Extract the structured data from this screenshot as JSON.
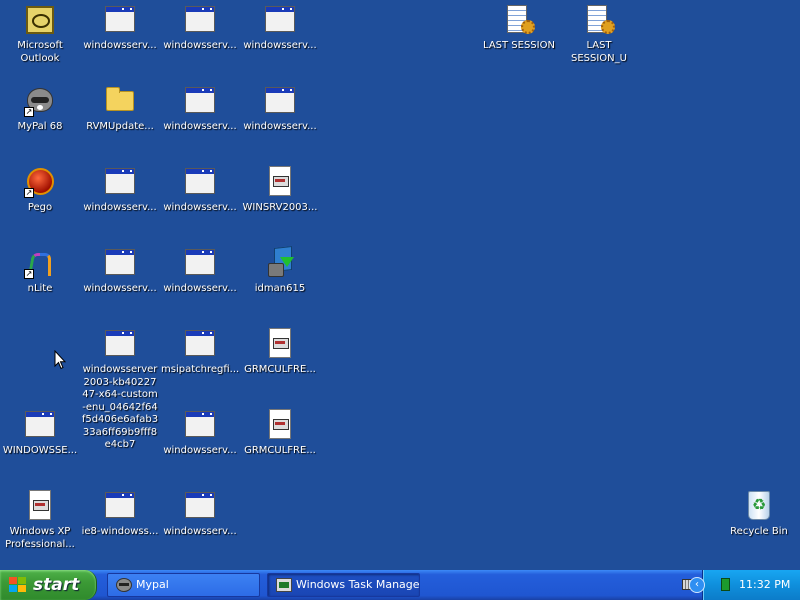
{
  "desktop": {
    "icons": [
      {
        "name": "outlook",
        "type": "outlook",
        "label": "Microsoft Outlook"
      },
      {
        "name": "windowsserv-1",
        "type": "window",
        "label": "windowsserv..."
      },
      {
        "name": "windowsserv-2",
        "type": "window",
        "label": "windowsserv..."
      },
      {
        "name": "windowsserv-3",
        "type": "window",
        "label": "windowsserv..."
      },
      {
        "name": "last-session",
        "type": "log",
        "label": "LAST SESSION"
      },
      {
        "name": "last-session-u",
        "type": "log",
        "label": "LAST SESSION_U"
      },
      {
        "name": "mypal",
        "type": "raccoon",
        "label": "MyPal 68"
      },
      {
        "name": "rvmupdate",
        "type": "folder",
        "label": "RVMUpdate..."
      },
      {
        "name": "windowsserv-4",
        "type": "window",
        "label": "windowsserv..."
      },
      {
        "name": "windowsserv-5",
        "type": "window",
        "label": "windowsserv..."
      },
      {
        "name": "pego",
        "type": "pego",
        "label": "Pego"
      },
      {
        "name": "windowsserv-6",
        "type": "window",
        "label": "windowsserv..."
      },
      {
        "name": "windowsserv-7",
        "type": "window",
        "label": "windowsserv..."
      },
      {
        "name": "winsrv2003",
        "type": "setup",
        "label": "WINSRV2003..."
      },
      {
        "name": "nlite",
        "type": "nlite",
        "label": "nLite"
      },
      {
        "name": "windowsserv-8",
        "type": "window",
        "label": "windowsserv..."
      },
      {
        "name": "windowsserv-9",
        "type": "window",
        "label": "windowsserv..."
      },
      {
        "name": "idman615",
        "type": "idman",
        "label": "idman615"
      },
      {
        "name": "windowsserver-kb",
        "type": "window",
        "label": "windowsserver2003-kb4022747-x64-custom-enu_04642f64f5d406e6afab333a6ff69b9fff8e4cb7"
      },
      {
        "name": "msipatchregfi",
        "type": "window",
        "label": "msipatchregfi..."
      },
      {
        "name": "grmculfre-1",
        "type": "setup",
        "label": "GRMCULFRE..."
      },
      {
        "name": "windowsse-caps",
        "type": "window",
        "label": "WINDOWSSE..."
      },
      {
        "name": "windowsserv-10",
        "type": "window",
        "label": "windowsserv..."
      },
      {
        "name": "grmculfre-2",
        "type": "setup",
        "label": "GRMCULFRE..."
      },
      {
        "name": "winxp-pro",
        "type": "setup",
        "label": "Windows XP Professional..."
      },
      {
        "name": "ie8-windowss",
        "type": "window",
        "label": "ie8-windowss..."
      },
      {
        "name": "windowsserv-11",
        "type": "window",
        "label": "windowsserv..."
      },
      {
        "name": "recycle-bin",
        "type": "bin",
        "label": "Recycle Bin"
      }
    ]
  },
  "taskbar": {
    "start_label": "start",
    "tasks": [
      {
        "label": "Mypal",
        "icon": "mypal-icon"
      },
      {
        "label": "Windows Task Manager",
        "icon": "task-manager-icon"
      }
    ],
    "clock": "11:32 PM"
  },
  "colors": {
    "desktop_bg": "#1f4e9a",
    "taskbar": "#245edb",
    "start_button": "#3c9a36",
    "tray": "#0f8fdc"
  }
}
